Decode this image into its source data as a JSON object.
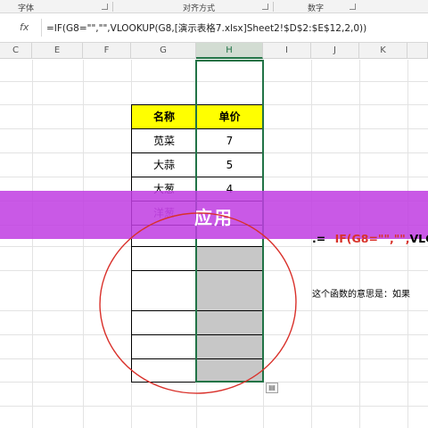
{
  "ribbon": {
    "groups": [
      "字体",
      "对齐方式",
      "数字"
    ]
  },
  "formula_bar": {
    "fx_label": "fx",
    "formula": "=IF(G8=\"\",\"\",VLOOKUP(G8,[演示表格7.xlsx]Sheet2!$D$2:$E$12,2,0))"
  },
  "columns": [
    "C",
    "E",
    "F",
    "G",
    "H",
    "I",
    "J",
    "K"
  ],
  "selected_column": "H",
  "table": {
    "headers": [
      "名称",
      "单价"
    ],
    "rows": [
      {
        "name": "苋菜",
        "price": "7"
      },
      {
        "name": "大蒜",
        "price": "5"
      },
      {
        "name": "大葱",
        "price": "4"
      },
      {
        "name": "洋葱",
        "price": ""
      }
    ]
  },
  "banner": {
    "text": "应用"
  },
  "formula_display": {
    "prefix": ".=",
    "highlight": "IF(G8=\"\",\"\",",
    "suffix": "VLC"
  },
  "explanation": "这个函数的意思是：如果",
  "paste_icon_label": "paste-options",
  "colors": {
    "header_fill": "#ffff00",
    "banner": "#c03ee2",
    "highlight_circle": "#d9302a",
    "selection": "#217346",
    "formula_red": "#d8322a"
  }
}
